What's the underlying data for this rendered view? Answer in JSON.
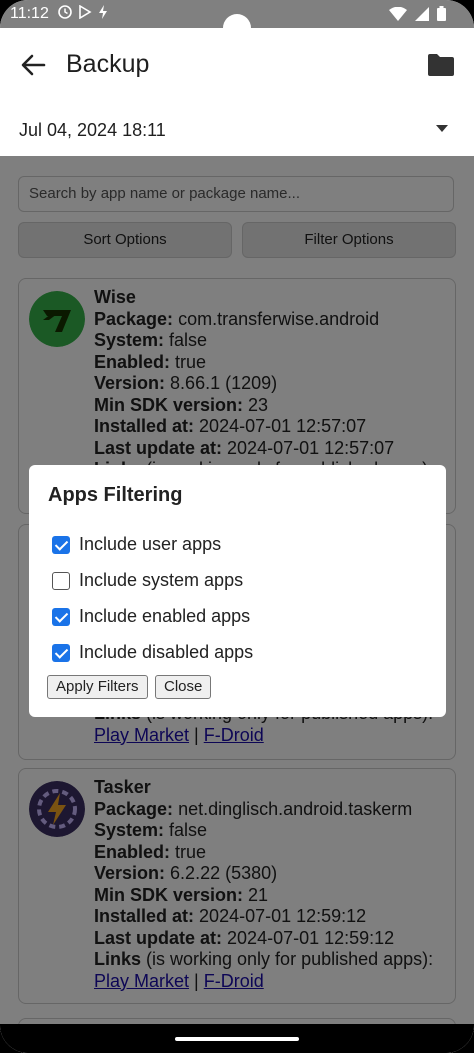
{
  "status_bar": {
    "time": "11:12"
  },
  "app_bar": {
    "title": "Backup",
    "date_selector": "Jul 04, 2024 18:11"
  },
  "search": {
    "placeholder": "Search by app name or package name..."
  },
  "buttons": {
    "sort": "Sort Options",
    "filter": "Filter Options"
  },
  "labels": {
    "package": "Package:",
    "system": "System:",
    "enabled": "Enabled:",
    "version": "Version:",
    "min_sdk": "Min SDK version:",
    "installed": "Installed at:",
    "last_update": "Last update at:",
    "links": "Links",
    "links_note": " (is working only for published apps):",
    "play_market": "Play Market",
    "separator": " | ",
    "f_droid": "F-Droid"
  },
  "apps": [
    {
      "name": "Wise",
      "package": "com.transferwise.android",
      "system": "false",
      "enabled": "true",
      "version": "8.66.1 (1209)",
      "min_sdk": "23",
      "installed": "2024-07-01 12:57:07",
      "last_update": "2024-07-01 12:57:07",
      "icon": "wise-icon",
      "icon_color": "#37b34a"
    },
    {
      "name": "Tasker",
      "package": "net.dinglisch.android.taskerm",
      "system": "false",
      "enabled": "true",
      "version": "6.2.22 (5380)",
      "min_sdk": "21",
      "installed": "2024-07-01 12:59:12",
      "last_update": "2024-07-01 12:59:12",
      "icon": "tasker-icon",
      "icon_color": "#3b2f63"
    }
  ],
  "dialog": {
    "title": "Apps Filtering",
    "options": [
      {
        "label": "Include user apps",
        "checked": true
      },
      {
        "label": "Include system apps",
        "checked": false
      },
      {
        "label": "Include enabled apps",
        "checked": true
      },
      {
        "label": "Include disabled apps",
        "checked": true
      }
    ],
    "apply": "Apply Filters",
    "close": "Close"
  },
  "colors": {
    "accent": "#1a73e8",
    "link": "#1a0dab"
  }
}
